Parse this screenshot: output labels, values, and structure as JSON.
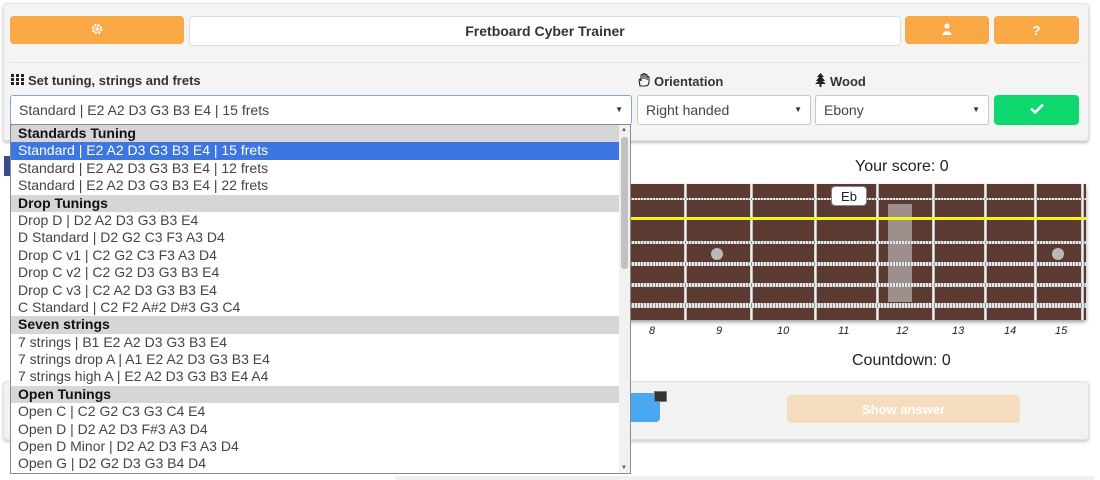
{
  "header": {
    "settings_icon": "gear-icon",
    "title": "Fretboard Cyber Trainer",
    "user_icon": "user-icon",
    "help_label": "?"
  },
  "controls": {
    "tuning_label": "Set tuning, strings and frets",
    "tuning_value": "Standard | E2 A2 D3 G3 B3 E4 | 15 frets",
    "orientation_label": "Orientation",
    "orientation_value": "Right handed",
    "wood_label": "Wood",
    "wood_value": "Ebony",
    "confirm_icon": "check-icon"
  },
  "game": {
    "score_text": "Your score: 0",
    "countdown_text": "Countdown: 0",
    "note_label": "Eb",
    "fret_numbers": [
      "8",
      "9",
      "10",
      "11",
      "12",
      "13",
      "14",
      "15"
    ],
    "show_answer_label": "Show answer"
  },
  "dropdown": {
    "groups": [
      {
        "label": "Standards Tuning",
        "options": [
          "Standard | E2 A2 D3 G3 B3 E4 | 15 frets",
          "Standard | E2 A2 D3 G3 B3 E4 | 12 frets",
          "Standard | E2 A2 D3 G3 B3 E4 | 22 frets"
        ]
      },
      {
        "label": "Drop Tunings",
        "options": [
          "Drop D | D2 A2 D3 G3 B3 E4",
          "D Standard | D2 G2 C3 F3 A3 D4",
          "Drop C v1 | C2 G2 C3 F3 A3 D4",
          "Drop C v2 | C2 G2 D3 G3 B3 E4",
          "Drop C v3 | C2 A2 D3 G3 B3 E4",
          "C Standard | C2 F2 A#2 D#3 G3 C4"
        ]
      },
      {
        "label": "Seven strings",
        "options": [
          "7 strings | B1 E2 A2 D3 G3 B3 E4",
          "7 strings drop A | A1 E2 A2 D3 G3 B3 E4",
          "7 strings high A | E2 A2 D3 G3 B3 E4 A4"
        ]
      },
      {
        "label": "Open Tunings",
        "options": [
          "Open C | C2 G2 C3 G3 C4 E4",
          "Open D | D2 A2 D3 F#3 A3 D4",
          "Open D Minor | D2 A2 D3 F3 A3 D4",
          "Open G | D2 G2 D3 G3 B4 D4"
        ]
      }
    ]
  },
  "colors": {
    "accent_orange": "#f8a946",
    "confirm_green": "#0fd96e",
    "selection_blue": "#3d76e0",
    "highlight_string": "#f5f51e"
  }
}
